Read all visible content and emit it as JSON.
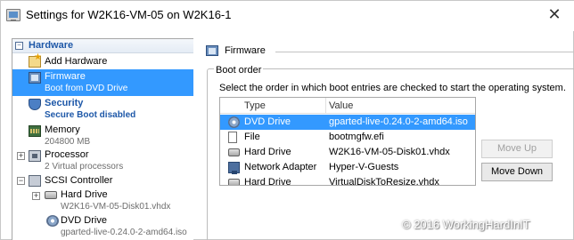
{
  "window": {
    "title": "Settings for W2K16-VM-05 on W2K16-1",
    "close_glyph": "✕"
  },
  "tree": {
    "section_label": "Hardware",
    "section_glyph": "−",
    "items": [
      {
        "name": "Add Hardware",
        "sub": "",
        "icon": "add-hardware-icon"
      },
      {
        "name": "Firmware",
        "sub": "Boot from DVD Drive",
        "icon": "firmware-icon"
      },
      {
        "name": "Security",
        "sub": "Secure Boot disabled",
        "icon": "security-shield-icon"
      },
      {
        "name": "Memory",
        "sub": "204800 MB",
        "icon": "memory-icon"
      },
      {
        "name": "Processor",
        "sub": "2 Virtual processors",
        "icon": "processor-icon"
      },
      {
        "name": "SCSI Controller",
        "sub": "",
        "icon": "scsi-controller-icon"
      },
      {
        "name": "Hard Drive",
        "sub": "W2K16-VM-05-Disk01.vhdx",
        "icon": "hard-drive-icon"
      },
      {
        "name": "DVD Drive",
        "sub": "gparted-live-0.24.0-2-amd64.iso",
        "icon": "dvd-drive-icon"
      }
    ],
    "expander_glyph": "+"
  },
  "firmware": {
    "header": "Firmware",
    "group_title": "Boot order",
    "instructions": "Select the order in which boot entries are checked to start the operating system.",
    "columns": {
      "type": "Type",
      "value": "Value"
    },
    "rows": [
      {
        "type": "DVD Drive",
        "value": "gparted-live-0.24.0-2-amd64.iso",
        "icon": "dvd-drive-icon",
        "selected": true
      },
      {
        "type": "File",
        "value": "bootmgfw.efi",
        "icon": "file-icon",
        "selected": false
      },
      {
        "type": "Hard Drive",
        "value": "W2K16-VM-05-Disk01.vhdx",
        "icon": "hard-drive-icon",
        "selected": false
      },
      {
        "type": "Network Adapter",
        "value": "Hyper-V-Guests",
        "icon": "network-adapter-icon",
        "selected": false
      },
      {
        "type": "Hard Drive",
        "value": "VirtualDiskToResize.vhdx",
        "icon": "hard-drive-icon",
        "selected": false
      }
    ],
    "move_up_label": "Move Up",
    "move_down_label": "Move Down"
  },
  "watermark": "© 2016 WorkingHardInIT",
  "colors": {
    "selection": "#3399ff",
    "section_text": "#1e58a8"
  }
}
